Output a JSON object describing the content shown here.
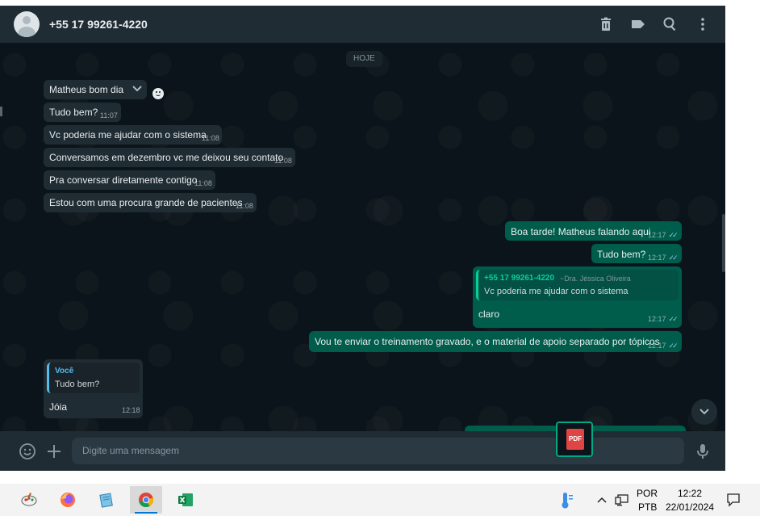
{
  "header": {
    "contact": "+55 17 99261-4220",
    "icons": [
      "trash-icon",
      "label-icon",
      "search-icon",
      "menu-icon"
    ]
  },
  "chat": {
    "date_chip": "HOJE",
    "incoming": [
      {
        "text": "Matheus bom dia",
        "time": ""
      },
      {
        "text": "Tudo bem?",
        "time": "11:07"
      },
      {
        "text": "Vc poderia me ajudar com o sistema",
        "time": "11:08"
      },
      {
        "text": "Conversamos em dezembro vc me deixou seu contato",
        "time": "11:08"
      },
      {
        "text": "Pra conversar diretamente contigo",
        "time": "11:08"
      },
      {
        "text": "Estou com uma procura grande de pacientes",
        "time": "11:08"
      }
    ],
    "outgoing": [
      {
        "text": "Boa tarde! Matheus falando aqui",
        "time": "12:17"
      },
      {
        "text": "Tudo bem?",
        "time": "12:17"
      },
      {
        "text": "claro",
        "time": "12:17",
        "quote_name": "+55 17 99261-4220",
        "quote_extra": "~Dra. Jéssica Oliveira",
        "quote_text": "Vc poderia me ajudar com o sistema"
      },
      {
        "text": "Vou te enviar o treinamento gravado, e o material de apoio separado por tópicos",
        "time": "12:17"
      }
    ],
    "reply": {
      "quote_name": "Você",
      "quote_text": "Tudo bem?",
      "text": "Jóia",
      "time": "12:18"
    },
    "ticks": "✓✓"
  },
  "footer": {
    "placeholder": "Digite uma mensagem",
    "pdf_label": "PDF"
  },
  "taskbar": {
    "apps": [
      "paint-app",
      "firefox-app",
      "notepad-app",
      "chrome-app",
      "excel-app"
    ],
    "lang_top": "POR",
    "lang_bottom": "PTB",
    "clock_time": "12:22",
    "clock_date": "22/01/2024"
  },
  "colors": {
    "chat_bg": "#0b141a",
    "incoming_bubble": "#202c33",
    "outgoing_bubble": "#005c4b",
    "accent": "#00a884"
  }
}
